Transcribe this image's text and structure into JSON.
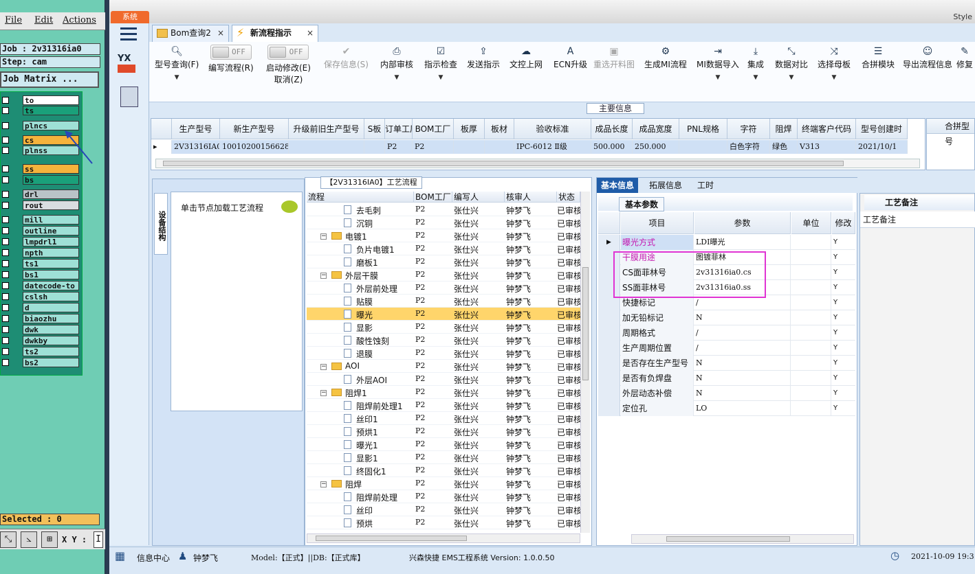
{
  "cam": {
    "menu": {
      "file": "File",
      "edit": "Edit",
      "actions": "Actions"
    },
    "job": "Job : 2v31316ia0",
    "step": "Step: cam",
    "job_matrix": "Job Matrix ...",
    "layers": [
      {
        "name": "to",
        "color": "#ffffff"
      },
      {
        "name": "ts",
        "color": "#1aa07a"
      },
      {
        "name": "plncs",
        "color": "#9ee0d6"
      },
      {
        "name": "cs",
        "color": "#f5b33c"
      },
      {
        "name": "plnss",
        "color": "#9ee0d6"
      },
      {
        "name": "ss",
        "color": "#f5b33c"
      },
      {
        "name": "bs",
        "color": "#1aa07a"
      },
      {
        "name": "drl",
        "color": "#b9c3c8"
      },
      {
        "name": "rout",
        "color": "#d9dde0"
      },
      {
        "name": "mill",
        "color": "#9ee0d6"
      },
      {
        "name": "outline",
        "color": "#9ee0d6"
      },
      {
        "name": "lmpdrl1",
        "color": "#9ee0d6"
      },
      {
        "name": "npth",
        "color": "#9ee0d6"
      },
      {
        "name": "ts1",
        "color": "#9ee0d6"
      },
      {
        "name": "bs1",
        "color": "#9ee0d6"
      },
      {
        "name": "datecode-to",
        "color": "#9ee0d6"
      },
      {
        "name": "cslsh",
        "color": "#9ee0d6"
      },
      {
        "name": "d",
        "color": "#9ee0d6"
      },
      {
        "name": "biaozhu",
        "color": "#9ee0d6"
      },
      {
        "name": "dwk",
        "color": "#9ee0d6"
      },
      {
        "name": "dwkby",
        "color": "#9ee0d6"
      },
      {
        "name": "ts2",
        "color": "#9ee0d6"
      },
      {
        "name": "bs2",
        "color": "#9ee0d6"
      }
    ],
    "selected": "Selected : 0",
    "xy_label": "X Y :"
  },
  "app": {
    "system_button": "系统",
    "style_label": "Style",
    "tabs": [
      {
        "label": "Bom查询2",
        "close": "×",
        "active": false
      },
      {
        "label": "新流程指示",
        "close": "×",
        "active": true
      }
    ],
    "toolbar": {
      "model_query": "型号查询(F)",
      "edit_flow_toggle": "OFF",
      "edit_flow": "编写流程(R)",
      "auto_modify_toggle": "OFF",
      "auto_modify": "启动修改(E)",
      "cancel": "取消(Z)",
      "save": "保存信息(S)",
      "internal_review": "内部审核",
      "instruction_check": "指示检查",
      "send_instruction": "发送指示",
      "upload_file": "文控上网",
      "ecn_upgrade": "ECN升级",
      "reselect_image": "重选开料图",
      "generate_mi": "生成MI流程",
      "mi_import": "MI数据导入",
      "integrate": "集成",
      "data_compare": "数据对比",
      "select_template": "选择母板",
      "combine_module": "合拼模块",
      "export_info": "导出流程信息",
      "more": "修复"
    },
    "main_info": {
      "title": "主要信息",
      "columns": [
        "生产型号",
        "新生产型号",
        "升级前旧生产型号",
        "S板",
        "订单工厂",
        "BOM工厂",
        "板厚",
        "板材",
        "验收标准",
        "成品长度",
        "成品宽度",
        "PNL规格",
        "字符",
        "阻焊",
        "终端客户代码",
        "型号创建时"
      ],
      "row": [
        "2V31316IA0",
        "10010200156628",
        "",
        "",
        "P2",
        "P2",
        "",
        "",
        "IPC-6012 Ⅱ级",
        "500.000",
        "250.000",
        "",
        "白色字符",
        "绿色",
        "V313",
        "2021/10/1"
      ],
      "combine_col": "合拼型号"
    },
    "device_structure": {
      "tab": "设备结构",
      "hint": "单击节点加载工艺流程"
    },
    "process": {
      "title": "【2V31316IA0】工艺流程",
      "columns": [
        "流程",
        "BOM工厂",
        "编写人",
        "核审人",
        "状态"
      ],
      "rows": [
        {
          "name": "去毛刺",
          "level": 2,
          "bom": "P2",
          "writer": "张仕兴",
          "reviewer": "钟梦飞",
          "status": "已审核"
        },
        {
          "name": "沉铜",
          "level": 2,
          "bom": "P2",
          "writer": "张仕兴",
          "reviewer": "钟梦飞",
          "status": "已审核"
        },
        {
          "name": "电镀1",
          "level": 1,
          "bom": "P2",
          "writer": "张仕兴",
          "reviewer": "钟梦飞",
          "status": "已审核"
        },
        {
          "name": "负片电镀1",
          "level": 2,
          "bom": "P2",
          "writer": "张仕兴",
          "reviewer": "钟梦飞",
          "status": "已审核"
        },
        {
          "name": "磨板1",
          "level": 2,
          "bom": "P2",
          "writer": "张仕兴",
          "reviewer": "钟梦飞",
          "status": "已审核"
        },
        {
          "name": "外层干膜",
          "level": 1,
          "bom": "P2",
          "writer": "张仕兴",
          "reviewer": "钟梦飞",
          "status": "已审核"
        },
        {
          "name": "外层前处理",
          "level": 2,
          "bom": "P2",
          "writer": "张仕兴",
          "reviewer": "钟梦飞",
          "status": "已审核"
        },
        {
          "name": "贴膜",
          "level": 2,
          "bom": "P2",
          "writer": "张仕兴",
          "reviewer": "钟梦飞",
          "status": "已审核"
        },
        {
          "name": "曝光",
          "level": 2,
          "bom": "P2",
          "writer": "张仕兴",
          "reviewer": "钟梦飞",
          "status": "已审核",
          "selected": true
        },
        {
          "name": "显影",
          "level": 2,
          "bom": "P2",
          "writer": "张仕兴",
          "reviewer": "钟梦飞",
          "status": "已审核"
        },
        {
          "name": "酸性蚀刻",
          "level": 2,
          "bom": "P2",
          "writer": "张仕兴",
          "reviewer": "钟梦飞",
          "status": "已审核"
        },
        {
          "name": "退膜",
          "level": 2,
          "bom": "P2",
          "writer": "张仕兴",
          "reviewer": "钟梦飞",
          "status": "已审核"
        },
        {
          "name": "AOI",
          "level": 1,
          "bom": "P2",
          "writer": "张仕兴",
          "reviewer": "钟梦飞",
          "status": "已审核"
        },
        {
          "name": "外层AOI",
          "level": 2,
          "bom": "P2",
          "writer": "张仕兴",
          "reviewer": "钟梦飞",
          "status": "已审核"
        },
        {
          "name": "阻焊1",
          "level": 1,
          "bom": "P2",
          "writer": "张仕兴",
          "reviewer": "钟梦飞",
          "status": "已审核"
        },
        {
          "name": "阻焊前处理1",
          "level": 2,
          "bom": "P2",
          "writer": "张仕兴",
          "reviewer": "钟梦飞",
          "status": "已审核"
        },
        {
          "name": "丝印1",
          "level": 2,
          "bom": "P2",
          "writer": "张仕兴",
          "reviewer": "钟梦飞",
          "status": "已审核"
        },
        {
          "name": "预烘1",
          "level": 2,
          "bom": "P2",
          "writer": "张仕兴",
          "reviewer": "钟梦飞",
          "status": "已审核"
        },
        {
          "name": "曝光1",
          "level": 2,
          "bom": "P2",
          "writer": "张仕兴",
          "reviewer": "钟梦飞",
          "status": "已审核"
        },
        {
          "name": "显影1",
          "level": 2,
          "bom": "P2",
          "writer": "张仕兴",
          "reviewer": "钟梦飞",
          "status": "已审核"
        },
        {
          "name": "终固化1",
          "level": 2,
          "bom": "P2",
          "writer": "张仕兴",
          "reviewer": "钟梦飞",
          "status": "已审核"
        },
        {
          "name": "阻焊",
          "level": 1,
          "bom": "P2",
          "writer": "张仕兴",
          "reviewer": "钟梦飞",
          "status": "已审核"
        },
        {
          "name": "阻焊前处理",
          "level": 2,
          "bom": "P2",
          "writer": "张仕兴",
          "reviewer": "钟梦飞",
          "status": "已审核"
        },
        {
          "name": "丝印",
          "level": 2,
          "bom": "P2",
          "writer": "张仕兴",
          "reviewer": "钟梦飞",
          "status": "已审核"
        },
        {
          "name": "预烘",
          "level": 2,
          "bom": "P2",
          "writer": "张仕兴",
          "reviewer": "钟梦飞",
          "status": "已审核"
        }
      ]
    },
    "info": {
      "tabs": [
        "基本信息",
        "拓展信息",
        "工时"
      ],
      "section": "基本参数",
      "columns": [
        "项目",
        "参数",
        "单位",
        "修改"
      ],
      "rows": [
        {
          "key": "曝光方式",
          "value": "LDI曝光",
          "unit": "",
          "mod": "Y",
          "highlight": true
        },
        {
          "key": "干膜用途",
          "value": "图镀菲林",
          "unit": "",
          "mod": "Y",
          "highlight": true
        },
        {
          "key": "CS面菲林号",
          "value": "2v31316ia0.cs",
          "unit": "",
          "mod": "Y"
        },
        {
          "key": "SS面菲林号",
          "value": "2v31316ia0.ss",
          "unit": "",
          "mod": "Y"
        },
        {
          "key": "快捷标记",
          "value": "/",
          "unit": "",
          "mod": "Y"
        },
        {
          "key": "加无铅标记",
          "value": "N",
          "unit": "",
          "mod": "Y"
        },
        {
          "key": "周期格式",
          "value": "/",
          "unit": "",
          "mod": "Y"
        },
        {
          "key": "生产周期位置",
          "value": "/",
          "unit": "",
          "mod": "Y"
        },
        {
          "key": "是否存在生产型号",
          "value": "N",
          "unit": "",
          "mod": "Y"
        },
        {
          "key": "是否有负焊盘",
          "value": "N",
          "unit": "",
          "mod": "Y"
        },
        {
          "key": "外层动态补偿",
          "value": "N",
          "unit": "",
          "mod": "Y"
        },
        {
          "key": "定位孔",
          "value": "LO",
          "unit": "",
          "mod": "Y"
        }
      ]
    },
    "remark": {
      "title": "工艺备注",
      "label": "工艺备注"
    },
    "status": {
      "info_center": "信息中心",
      "user": "钟梦飞",
      "model": "Model:【正式】||DB:【正式库】",
      "system": "兴森快捷 EMS工程系统 Version: 1.0.0.50",
      "datetime": "2021-10-09 19:3"
    }
  }
}
